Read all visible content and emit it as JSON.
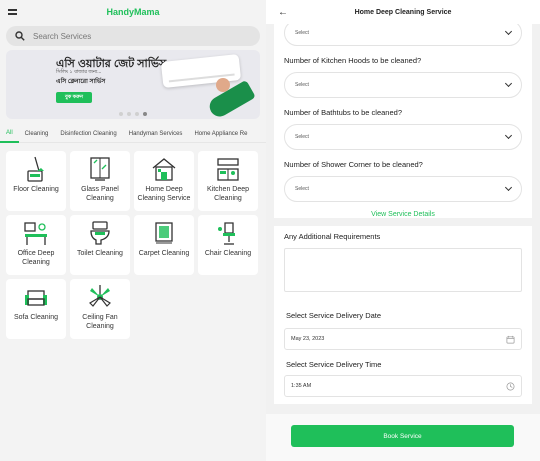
{
  "left": {
    "brand": "HandyMama",
    "search": {
      "placeholder": "Search Services"
    },
    "banner": {
      "line1": "এসি ওয়াটার জেট সার্ভিস",
      "line2": "সিলিং ১ বাজার জন্য...",
      "line3": "এসি ক্লেনারো সার্ভিস",
      "cta": "বুক করুন",
      "slide_count": 4,
      "active_slide": 3
    },
    "tabs": [
      "All",
      "Cleaning",
      "Disinfection Cleaning",
      "Handyman Services",
      "Home Appliance Re"
    ],
    "active_tab": 0,
    "services": [
      {
        "label": "Floor Cleaning",
        "icon": "mop-bucket-icon"
      },
      {
        "label": "Glass Panel Cleaning",
        "icon": "glass-panel-icon"
      },
      {
        "label": "Home Deep Cleaning Service",
        "icon": "house-icon"
      },
      {
        "label": "Kitchen Deep Cleaning",
        "icon": "kitchen-icon"
      },
      {
        "label": "Office Deep Cleaning",
        "icon": "office-icon"
      },
      {
        "label": "Toilet Cleaning",
        "icon": "toilet-icon"
      },
      {
        "label": "Carpet Cleaning",
        "icon": "carpet-icon"
      },
      {
        "label": "Chair Cleaning",
        "icon": "chair-icon"
      },
      {
        "label": "Sofa Cleaning",
        "icon": "sofa-icon"
      },
      {
        "label": "Ceiling Fan Cleaning",
        "icon": "ceiling-fan-icon"
      }
    ],
    "accent": "#1fbf5a"
  },
  "right": {
    "title": "Home Deep Cleaning Service",
    "top_select": "Select",
    "questions": [
      {
        "label": "Number of Kitchen Hoods to be cleaned?",
        "value": "Select"
      },
      {
        "label": "Number of Bathtubs to be cleaned?",
        "value": "Select"
      },
      {
        "label": "Number of Shower Corner to be cleaned?",
        "value": "Select"
      }
    ],
    "view_details": "View Service Details",
    "additional_requirements": "Any Additional Requirements",
    "delivery_date_label": "Select Service Delivery Date",
    "delivery_date": "May 23, 2023",
    "delivery_time_label": "Select Service Delivery Time",
    "delivery_time": "1:35 AM",
    "book_button": "Book Service"
  }
}
